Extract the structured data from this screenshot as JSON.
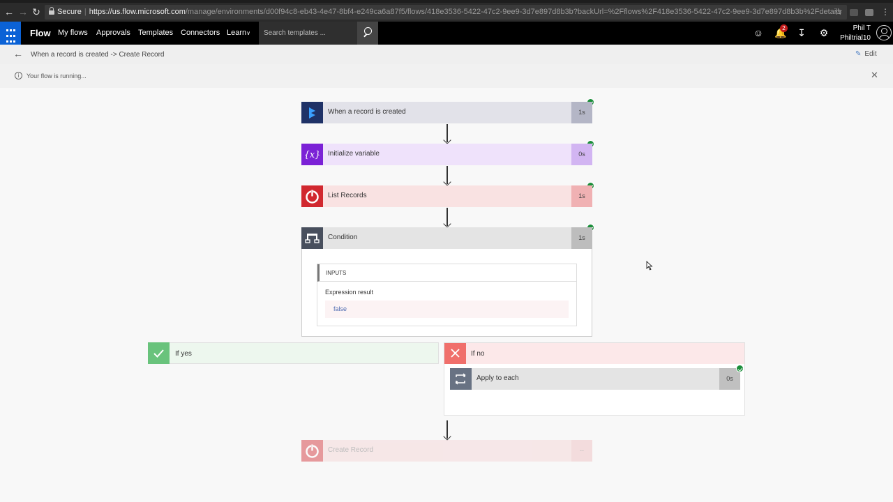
{
  "browser": {
    "secure_label": "Secure",
    "url_host": "https://us.flow.microsoft.com",
    "url_path": "/manage/environments/d00f94c8-eb43-4e47-8bf4-e249ca6a87f5/flows/418e3536-5422-47c2-9ee9-3d7e897d8b3b?backUrl=%2Fflows%2F418e3536-5422-47c2-9ee9-3d7e897d8b3b%2Fdetails"
  },
  "header": {
    "brand": "Flow",
    "nav": [
      "My flows",
      "Approvals",
      "Templates",
      "Connectors",
      "Learn"
    ],
    "search_placeholder": "Search templates ...",
    "notification_count": "2",
    "user_name": "Phil T",
    "user_tenant": "Philtrial10"
  },
  "subheader": {
    "breadcrumb": "When a record is created -> Create Record",
    "edit_label": "Edit"
  },
  "info": {
    "message": "Your flow is running..."
  },
  "steps": [
    {
      "title": "When a record is created",
      "duration": "1s",
      "icon": "dynamics-icon",
      "accent": "#1f3267",
      "bg": "#e2e2e9",
      "dur_bg": "#b4b6c6"
    },
    {
      "title": "Initialize variable",
      "duration": "0s",
      "icon": "variable-icon",
      "accent": "#7b21d6",
      "bg": "#efe2fb",
      "dur_bg": "#d2b5f2"
    },
    {
      "title": "List Records",
      "duration": "1s",
      "icon": "power-icon",
      "accent": "#d1282f",
      "bg": "#f9e2e2",
      "dur_bg": "#f0b1b3"
    },
    {
      "title": "Condition",
      "duration": "1s",
      "icon": "condition-icon",
      "accent": "#484f5d",
      "bg": "#e4e4e4",
      "dur_bg": "#bdbdbd"
    }
  ],
  "condition": {
    "inputs_label": "INPUTS",
    "expression_label": "Expression result",
    "expression_value": "false"
  },
  "branches": {
    "yes_label": "If yes",
    "no_label": "If no",
    "apply_each_title": "Apply to each",
    "apply_each_duration": "0s"
  },
  "final_step": {
    "title": "Create Record",
    "duration": "--"
  }
}
